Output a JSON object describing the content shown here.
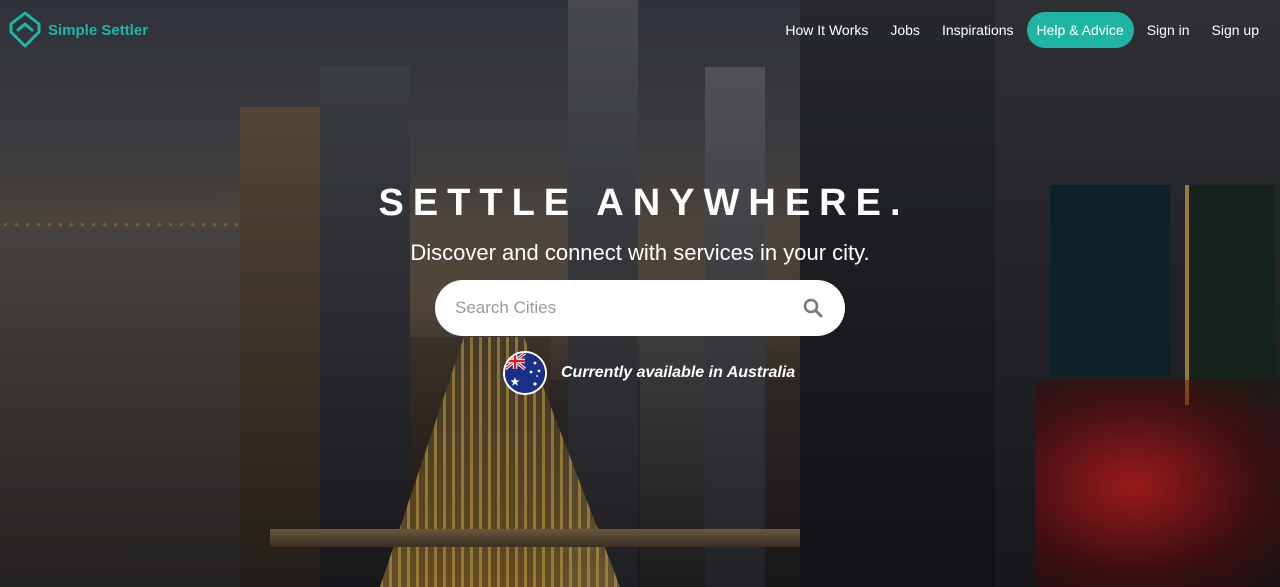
{
  "brand": {
    "name": "Simple Settler",
    "accent_color": "#1eb5a5",
    "logo_icon": "map-pin-logo-icon"
  },
  "nav": {
    "items": [
      {
        "label": "How It Works",
        "accent": false
      },
      {
        "label": "Jobs",
        "accent": false
      },
      {
        "label": "Inspirations",
        "accent": false
      },
      {
        "label": "Help & Advice",
        "accent": true
      },
      {
        "label": "Sign in",
        "accent": false
      },
      {
        "label": "Sign up",
        "accent": false
      }
    ]
  },
  "hero": {
    "headline": "SETTLE ANYWHERE.",
    "subheadline": "Discover and connect with services in your city.",
    "search": {
      "placeholder": "Search Cities",
      "value": "",
      "icon": "search-icon"
    },
    "availability": {
      "flag_icon": "australia-flag-icon",
      "text": "Currently available in Australia"
    }
  }
}
